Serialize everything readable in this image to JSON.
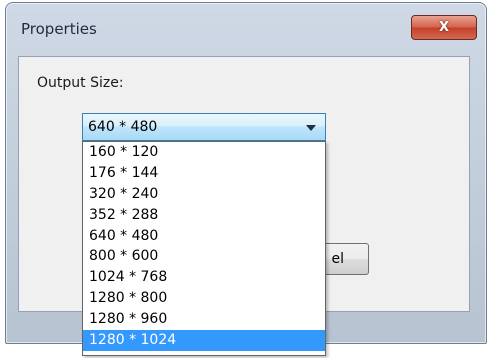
{
  "window": {
    "title": "Properties",
    "close_label": "X"
  },
  "output_size": {
    "label": "Output Size:",
    "selected_value": "640 * 480",
    "options": [
      "160 * 120",
      "176 * 144",
      "320 * 240",
      "352 * 288",
      "640 * 480",
      "800 * 600",
      "1024 * 768",
      "1280 * 800",
      "1280 * 960",
      "1280 * 1024"
    ],
    "highlighted_index": 9
  },
  "buttons": {
    "partial_label": "el"
  },
  "colors": {
    "highlight": "#3399ff",
    "close_button": "#d6614a"
  }
}
